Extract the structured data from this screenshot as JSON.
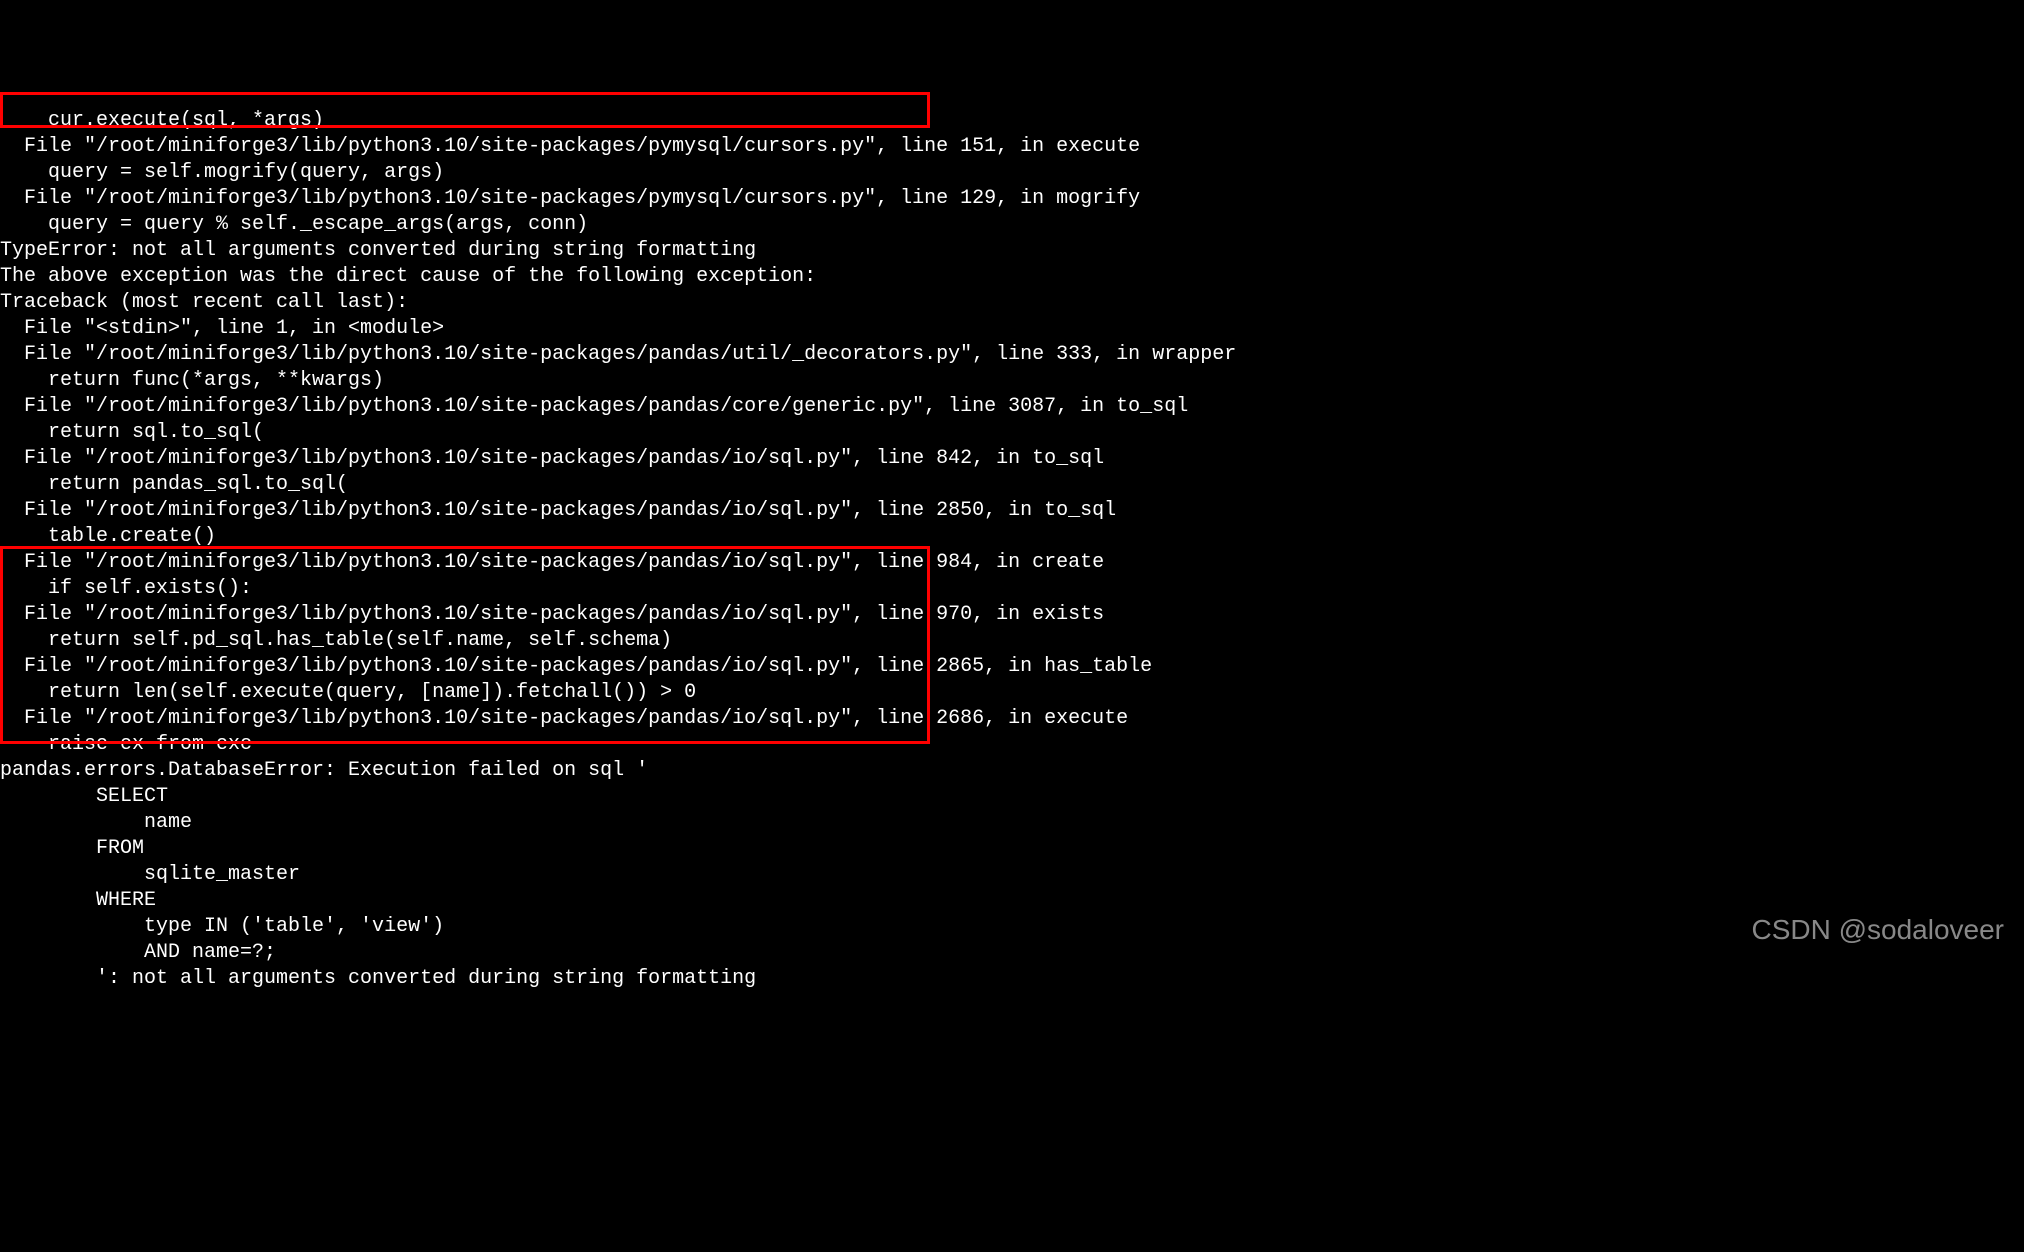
{
  "terminal": {
    "lines": [
      "    cur.execute(sql, *args)",
      "  File \"/root/miniforge3/lib/python3.10/site-packages/pymysql/cursors.py\", line 151, in execute",
      "    query = self.mogrify(query, args)",
      "  File \"/root/miniforge3/lib/python3.10/site-packages/pymysql/cursors.py\", line 129, in mogrify",
      "    query = query % self._escape_args(args, conn)",
      "TypeError: not all arguments converted during string formatting",
      "",
      "The above exception was the direct cause of the following exception:",
      "",
      "Traceback (most recent call last):",
      "  File \"<stdin>\", line 1, in <module>",
      "  File \"/root/miniforge3/lib/python3.10/site-packages/pandas/util/_decorators.py\", line 333, in wrapper",
      "    return func(*args, **kwargs)",
      "  File \"/root/miniforge3/lib/python3.10/site-packages/pandas/core/generic.py\", line 3087, in to_sql",
      "    return sql.to_sql(",
      "  File \"/root/miniforge3/lib/python3.10/site-packages/pandas/io/sql.py\", line 842, in to_sql",
      "    return pandas_sql.to_sql(",
      "  File \"/root/miniforge3/lib/python3.10/site-packages/pandas/io/sql.py\", line 2850, in to_sql",
      "    table.create()",
      "  File \"/root/miniforge3/lib/python3.10/site-packages/pandas/io/sql.py\", line 984, in create",
      "    if self.exists():",
      "  File \"/root/miniforge3/lib/python3.10/site-packages/pandas/io/sql.py\", line 970, in exists",
      "    return self.pd_sql.has_table(self.name, self.schema)",
      "  File \"/root/miniforge3/lib/python3.10/site-packages/pandas/io/sql.py\", line 2865, in has_table",
      "    return len(self.execute(query, [name]).fetchall()) > 0",
      "  File \"/root/miniforge3/lib/python3.10/site-packages/pandas/io/sql.py\", line 2686, in execute",
      "    raise ex from exc",
      "pandas.errors.DatabaseError: Execution failed on sql '",
      "        SELECT",
      "            name",
      "        FROM",
      "            sqlite_master",
      "        WHERE",
      "            type IN ('table', 'view')",
      "            AND name=?;",
      "        ': not all arguments converted during string formatting"
    ]
  },
  "watermark": "CSDN @sodaloveer",
  "highlights": {
    "box1": {
      "description": "TypeError highlight",
      "border_color": "#ff0000"
    },
    "box2": {
      "description": "DatabaseError highlight",
      "border_color": "#ff0000"
    }
  }
}
